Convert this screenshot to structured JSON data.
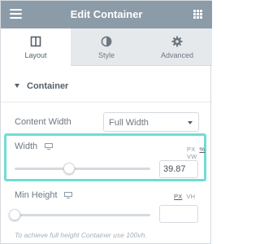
{
  "header": {
    "title": "Edit Container",
    "background": "#8c9ba8"
  },
  "tabs": [
    {
      "label": "Layout",
      "icon": "columns-icon",
      "active": true
    },
    {
      "label": "Style",
      "icon": "half-circle-icon",
      "active": false
    },
    {
      "label": "Advanced",
      "icon": "gear-icon",
      "active": false
    }
  ],
  "section": {
    "title": "Container",
    "expanded": true
  },
  "content_width": {
    "label": "Content Width",
    "value": "Full Width"
  },
  "width": {
    "label": "Width",
    "units": [
      "PX",
      "%",
      "VW"
    ],
    "active_unit": "%",
    "value": "39.87",
    "slider_fraction": 0.3987,
    "highlight_color": "#71dbd5"
  },
  "min_height": {
    "label": "Min Height",
    "units": [
      "PX",
      "VH"
    ],
    "active_unit": "PX",
    "value": "",
    "slider_fraction": 0
  },
  "note": "To achieve full height Container use 100vh."
}
